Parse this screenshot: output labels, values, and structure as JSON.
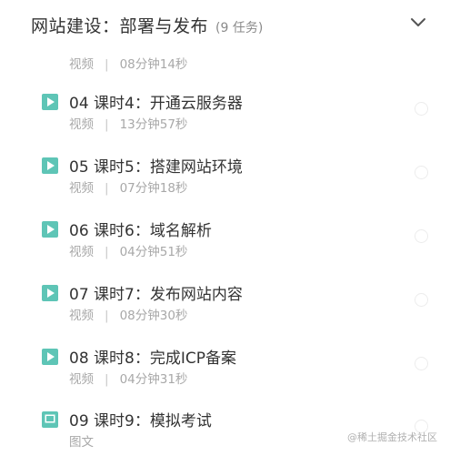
{
  "section": {
    "title": "网站建设：部署与发布",
    "task_count": "(9 任务)"
  },
  "first_item": {
    "type": "视频",
    "separator": "|",
    "duration": "08分钟14秒"
  },
  "lessons": [
    {
      "title": "04  课时4：开通云服务器",
      "type": "视频",
      "separator": "|",
      "duration": "13分钟57秒",
      "icon": "play-icon"
    },
    {
      "title": "05  课时5：搭建网站环境",
      "type": "视频",
      "separator": "|",
      "duration": "07分钟18秒",
      "icon": "play-icon"
    },
    {
      "title": "06  课时6：域名解析",
      "type": "视频",
      "separator": "|",
      "duration": "04分钟51秒",
      "icon": "play-icon"
    },
    {
      "title": "07  课时7：发布网站内容",
      "type": "视频",
      "separator": "|",
      "duration": "08分钟30秒",
      "icon": "play-icon"
    },
    {
      "title": "08  课时8：完成ICP备案",
      "type": "视频",
      "separator": "|",
      "duration": "04分钟31秒",
      "icon": "play-icon"
    },
    {
      "title": "09  课时9：模拟考试",
      "type": "图文",
      "icon": "document-icon"
    }
  ],
  "watermark": "@稀土掘金技术社区",
  "colors": {
    "accent": "#5ec5b6",
    "text": "#333333",
    "muted": "#a8a8a8"
  }
}
